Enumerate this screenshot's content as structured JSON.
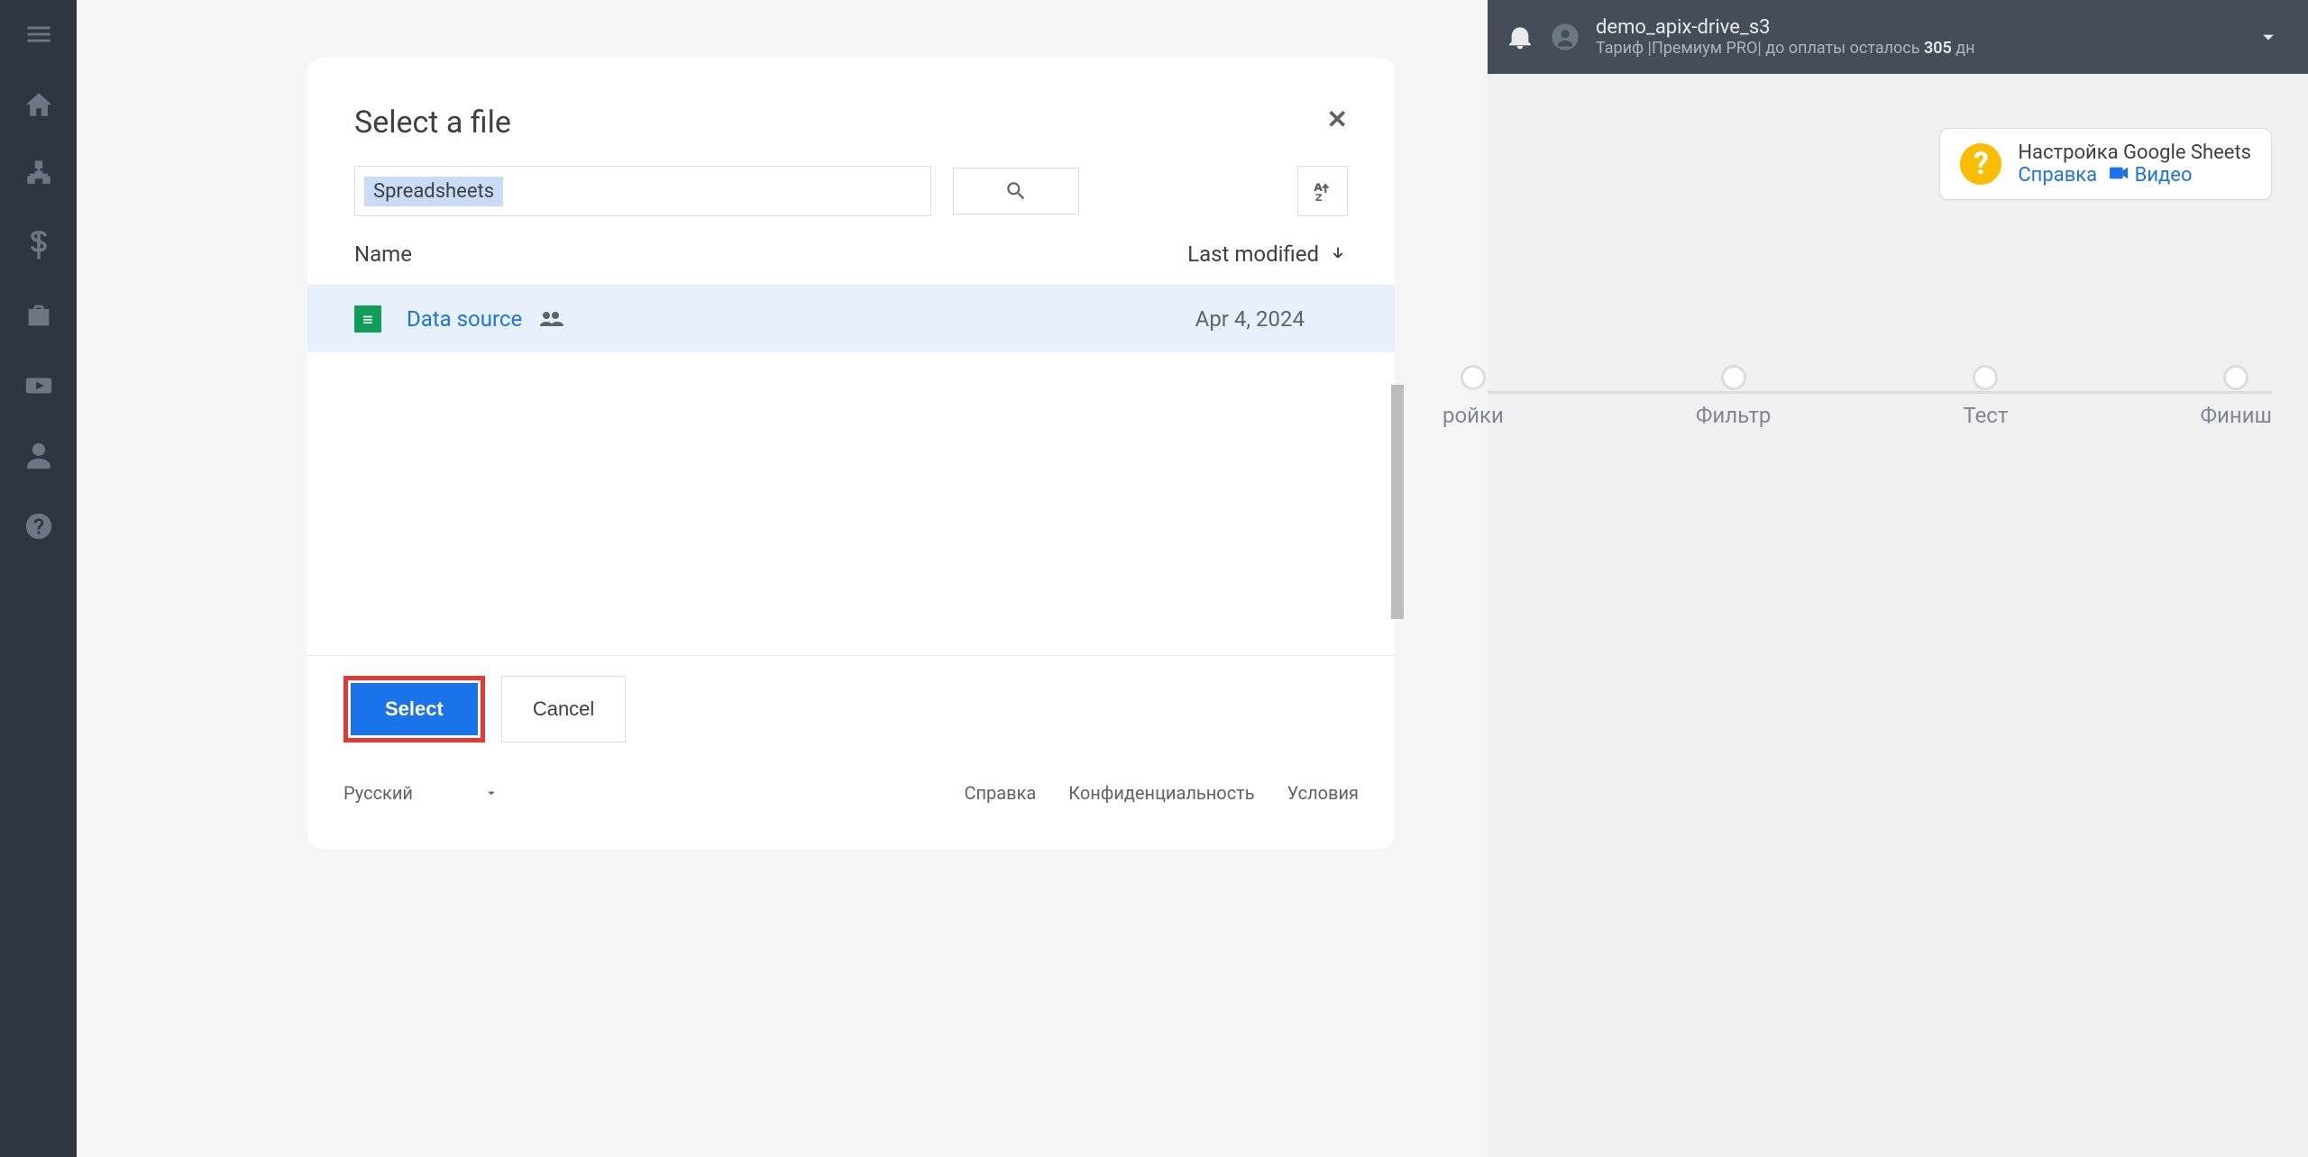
{
  "nav": {
    "icons": [
      "menu",
      "home",
      "sitemap",
      "dollar",
      "briefcase",
      "youtube",
      "user",
      "help"
    ]
  },
  "topbar": {
    "username": "demo_apix-drive_s3",
    "plan_prefix": "Тариф |Премиум PRO| до оплаты осталось ",
    "plan_days": "305",
    "plan_suffix": " дн"
  },
  "help_card": {
    "title": "Настройка Google Sheets",
    "help_link": "Справка",
    "video_link": "Видео"
  },
  "stepper": [
    "ройки",
    "Фильтр",
    "Тест",
    "Финиш"
  ],
  "modal": {
    "title": "Select a file",
    "filter_chip": "Spreadsheets",
    "columns": {
      "name": "Name",
      "modified": "Last modified"
    },
    "rows": [
      {
        "name": "Data source",
        "date": "Apr 4, 2024"
      }
    ],
    "select_btn": "Select",
    "cancel_btn": "Cancel",
    "language": "Русский",
    "bottom_links": [
      "Справка",
      "Конфиденциальность",
      "Условия"
    ]
  }
}
